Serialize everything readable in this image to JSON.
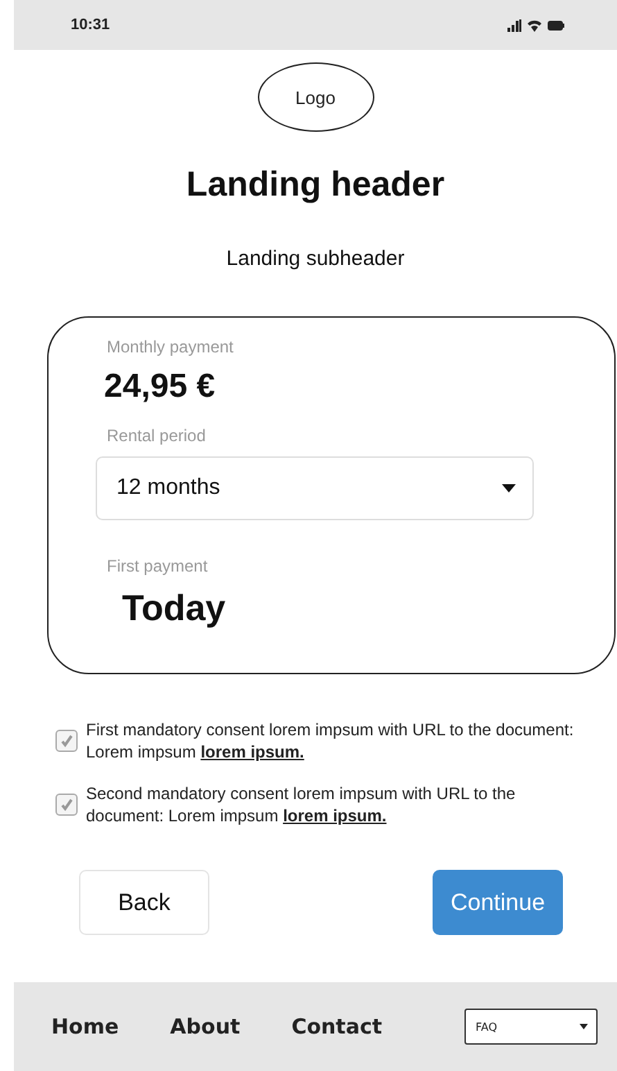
{
  "status_bar": {
    "time": "10:31"
  },
  "logo": "Logo",
  "header": "Landing header",
  "subheader": "Landing subheader",
  "card": {
    "fields": [
      {
        "kind": "amount",
        "label": "Monthly payment",
        "value": "24,95 €"
      },
      {
        "kind": "select",
        "label": "Rental period",
        "value": "12 months"
      },
      {
        "kind": "big",
        "label": "First payment",
        "value": "Today"
      }
    ]
  },
  "consents": [
    {
      "checked": true,
      "text": "First mandatory consent lorem impsum with URL to the document: Lorem impsum",
      "link": "lorem ipsum."
    },
    {
      "checked": true,
      "text": "Second mandatory consent lorem impsum with URL to the document: Lorem impsum",
      "link": "lorem ipsum."
    }
  ],
  "buttons": [
    {
      "kind": "secondary",
      "label": "Back"
    },
    {
      "kind": "primary",
      "label": "Continue"
    }
  ],
  "nav": {
    "links": [
      "Home",
      "About",
      "Contact"
    ],
    "dropdown": "FAQ"
  }
}
